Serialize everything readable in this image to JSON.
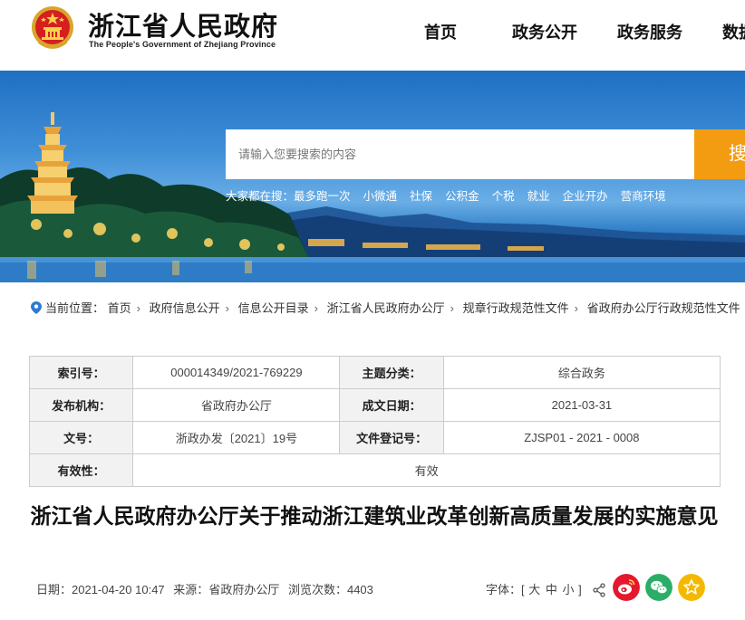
{
  "header": {
    "site_title": "浙江省人民政府",
    "site_subtitle": "The People's Government of Zhejiang Province",
    "nav": [
      "首页",
      "政务公开",
      "政务服务",
      "数据"
    ]
  },
  "search": {
    "placeholder": "请输入您要搜索的内容",
    "button_label": "搜索"
  },
  "hot_search": {
    "label": "大家都在搜：",
    "items": [
      "最多跑一次",
      "小微通",
      "社保",
      "公积金",
      "个税",
      "就业",
      "企业开办",
      "营商环境"
    ]
  },
  "breadcrumb": {
    "label": "当前位置：",
    "items": [
      "首页",
      "政府信息公开",
      "信息公开目录",
      "浙江省人民政府办公厅",
      "规章行政规范性文件",
      "省政府办公厅行政规范性文件"
    ]
  },
  "meta_table": {
    "index_label": "索引号：",
    "index_value": "000014349/2021-769229",
    "topic_label": "主题分类：",
    "topic_value": "综合政务",
    "issuer_label": "发布机构：",
    "issuer_value": "省政府办公厅",
    "date_label": "成文日期：",
    "date_value": "2021-03-31",
    "docno_label": "文号：",
    "docno_value": "浙政办发〔2021〕19号",
    "regno_label": "文件登记号：",
    "regno_value": "ZJSP01 - 2021 - 0008",
    "valid_label": "有效性：",
    "valid_value": "有效"
  },
  "document": {
    "title": "浙江省人民政府办公厅关于推动浙江建筑业改革创新高质量发展的实施意见",
    "date_label": "日期：",
    "date": "2021-04-20 10:47",
    "source_label": "来源：",
    "source": "省政府办公厅",
    "views_label": "浏览次数：",
    "views": "4403",
    "fontsize_label": "字体：[",
    "font_large": "大",
    "font_medium": "中",
    "font_small": "小",
    "fontsize_end": "]"
  },
  "colors": {
    "accent": "#f39c12",
    "weibo": "#e6162d",
    "wechat": "#2aae67",
    "favorite": "#f5b800"
  },
  "icons": [
    "national-emblem-icon",
    "location-pin-icon",
    "share-icon",
    "weibo-icon",
    "wechat-icon",
    "star-icon"
  ]
}
